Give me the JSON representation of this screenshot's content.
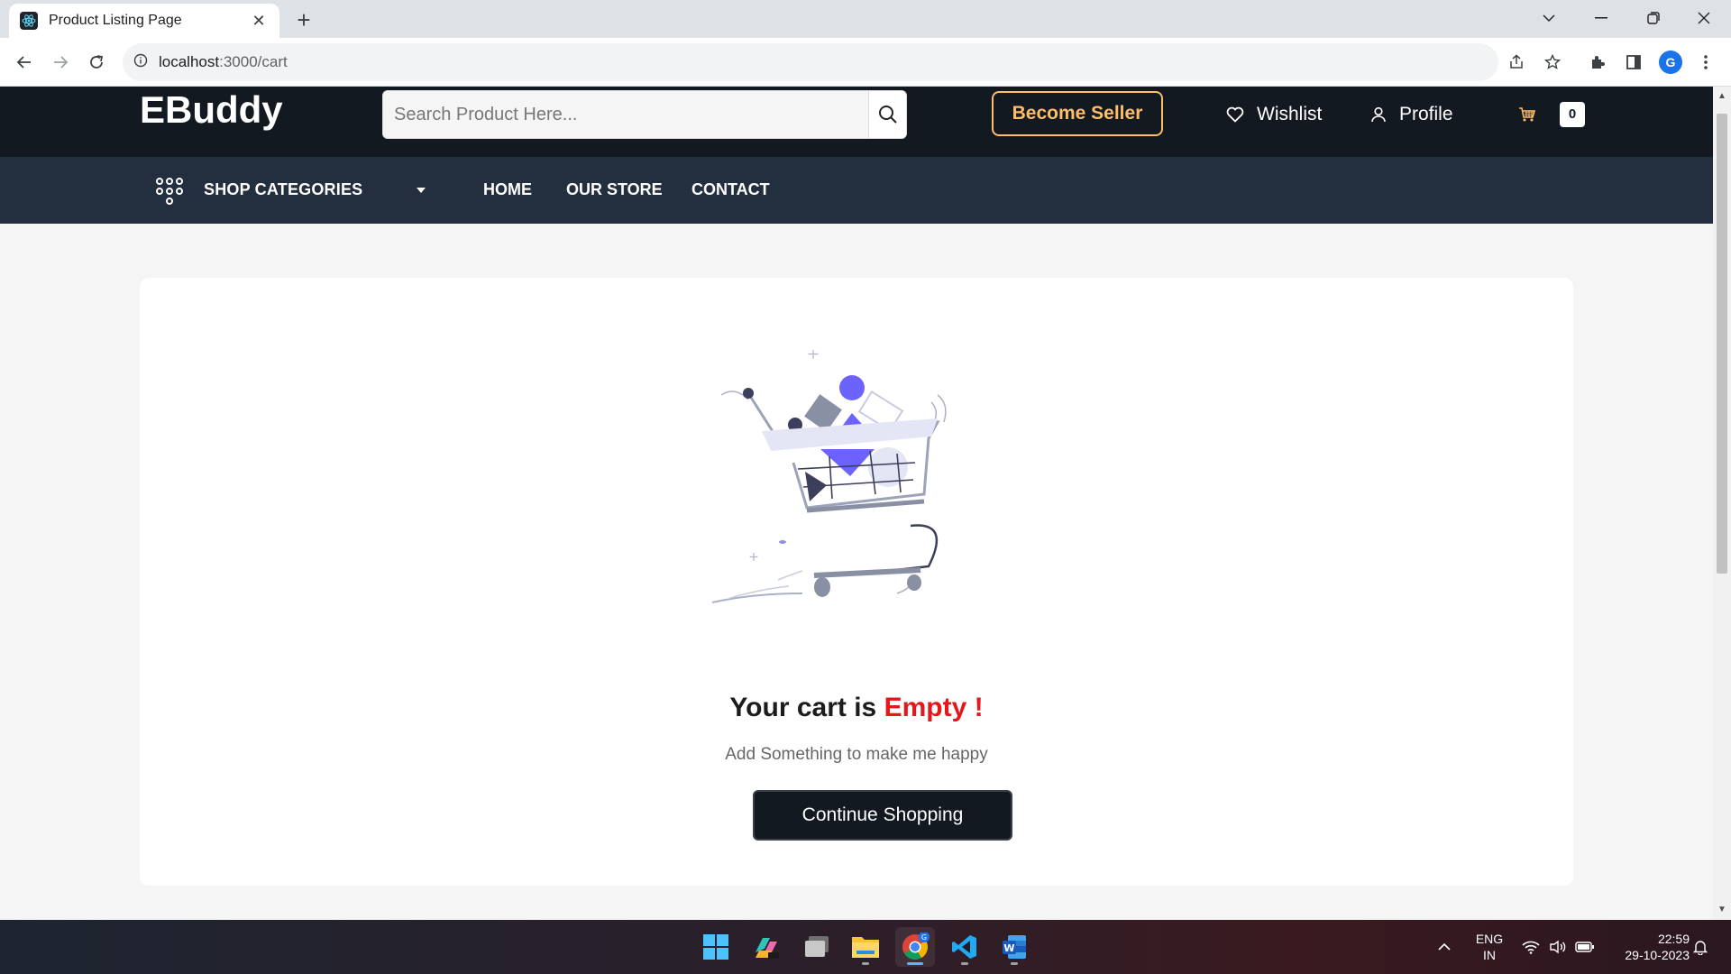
{
  "browser": {
    "tab_title": "Product Listing Page",
    "url_host": "localhost",
    "url_path": ":3000/cart",
    "profile_initial": "G"
  },
  "header": {
    "logo": "EBuddy",
    "search_placeholder": "Search Product Here...",
    "become_seller": "Become Seller",
    "wishlist": "Wishlist",
    "profile": "Profile",
    "cart_count": "0"
  },
  "menu": {
    "categories": "SHOP CATEGORIES",
    "links": [
      "HOME",
      "OUR STORE",
      "CONTACT"
    ]
  },
  "cart": {
    "title_prefix": "Your cart is",
    "title_accent": "Empty !",
    "subtitle": "Add Something to make me happy",
    "button": "Continue Shopping"
  },
  "taskbar": {
    "lang_top": "ENG",
    "lang_bottom": "IN",
    "time": "22:59",
    "date": "29-10-2023"
  },
  "colors": {
    "header_bg": "#131921",
    "menu_bg": "#232f3e",
    "seller_accent": "#febd69",
    "empty_accent": "#e4181b",
    "page_bg": "#f5f5f6"
  }
}
